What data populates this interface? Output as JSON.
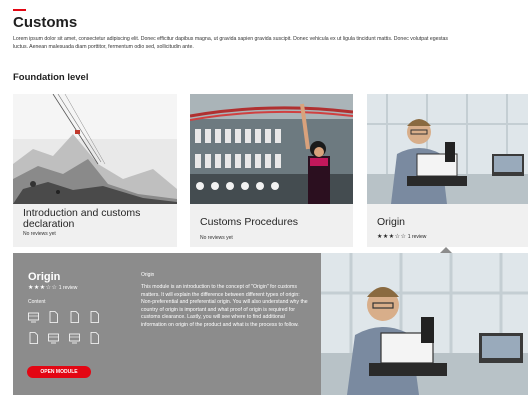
{
  "page": {
    "title": "Customs",
    "intro": "Lorem ipsum dolor sit amet, consectetur adipiscing elit. Donec efficitur dapibus magna, ut gravida sapien gravida suscipit. Donec vehicula ex ut ligula tincidunt mattis. Donec volutpat egestas luctus. Aenean malesuada diam porttitor, fermentum odio sed, sollicitudin ante.",
    "section_title": "Foundation level"
  },
  "cards": [
    {
      "title": "Introduction and customs declaration",
      "reviews": "No reviews yet",
      "image": "snowy-mountain-cable-car"
    },
    {
      "title": "Customs Procedures",
      "reviews": "No reviews yet",
      "image": "textile-factory-worker"
    },
    {
      "title": "Origin",
      "stars": "★★★☆☆",
      "reviews": "1 review",
      "rating": 3,
      "image": "engineer-with-robot"
    }
  ],
  "detail": {
    "title": "Origin",
    "stars": "★★★☆☆",
    "rating": 3,
    "reviews": "1 review",
    "content_label": "Content",
    "icons": [
      "video-icon",
      "document-icon",
      "document-icon",
      "document-icon",
      "document-icon",
      "video-icon",
      "video-icon",
      "document-icon"
    ],
    "subtitle": "Origin",
    "description": "This module is an introduction to the concept of \"Origin\" for customs matters. It will explain the difference between different types of origin: Non-preferential and preferential origin. You will also understand why the country of origin is important and what proof of origin is required for customs clearance. Lastly, you will see where to find additional information on origin of the product and what is the process to follow.",
    "button_label": "OPEN MODULE",
    "image": "engineer-with-robot"
  },
  "colors": {
    "accent": "#e30613",
    "detail_bg": "#8c8c8c",
    "card_bg": "#f0f0f0"
  }
}
